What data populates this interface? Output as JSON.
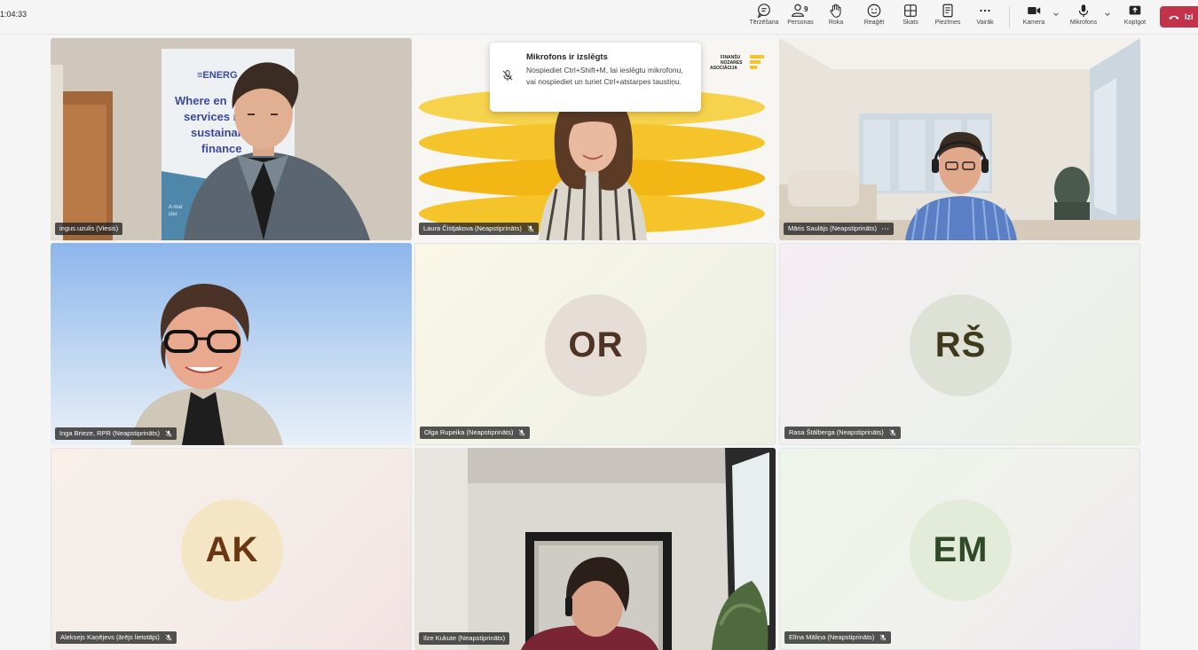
{
  "meeting": {
    "timer": "1:04:33"
  },
  "toolbar": {
    "chat_label": "Tērzēšana",
    "people_label": "Personas",
    "people_count": "9",
    "raise_label": "Roka",
    "react_label": "Reaģēt",
    "view_label": "Skats",
    "notes_label": "Piezīmes",
    "more_label": "Vairāk",
    "camera_label": "Kamera",
    "mic_label": "Mikrofons",
    "share_label": "Kopīgot",
    "leave_label": "Izi"
  },
  "toast": {
    "title": "Mikrofons ir izslēgts",
    "body": "Nospiediet Ctrl+Shift+M, lai ieslēgtu mikrofonu, vai nospiediet un turiet Ctrl+atstarpes taustiņu."
  },
  "participants": [
    {
      "name": "ingus.uzulis (Viesis)",
      "video": true
    },
    {
      "name": "Laura Čistjakova (Neapstiprināts)",
      "video": true,
      "muted": true
    },
    {
      "name": "Māris Saulājs (Neapstiprināts)",
      "video": true,
      "menu": "⋯"
    },
    {
      "name": "Inga Brieze, RPR (Neapstiprināts)",
      "video": true,
      "muted": true
    },
    {
      "name": "Olga Rupeika (Neapstiprināts)",
      "initials": "OR",
      "muted": true,
      "avatar_bg": "#e6ddd6",
      "avatar_fg": "#4f3325"
    },
    {
      "name": "Rasa Štālberga (Neapstiprināts)",
      "initials": "RŠ",
      "muted": true,
      "avatar_bg": "#dde1d6",
      "avatar_fg": "#3f3a1b"
    },
    {
      "name": "Aleksejs Kaņējevs (ārējs lietotājs)",
      "initials": "AK",
      "muted": true,
      "avatar_bg": "#f4e6c4",
      "avatar_fg": "#6b3611"
    },
    {
      "name": "Ilze Kukute (Neapstiprināts)",
      "video": true
    },
    {
      "name": "Elīna Māliņa (Neapstiprināts)",
      "initials": "EM",
      "muted": true,
      "avatar_bg": "#e3ecd9",
      "avatar_fg": "#2f4a28"
    }
  ],
  "backgrounds": {
    "banner_logo": "ENERG",
    "banner_text": "Where en services r sustainal finance",
    "banner_footer": "A mar cler",
    "fna_logo": "FINANŠU NOZARES ASOCIĀCIJA"
  },
  "colors": {
    "accent": "#c4314b",
    "tile_border": "#e0e0e0"
  }
}
